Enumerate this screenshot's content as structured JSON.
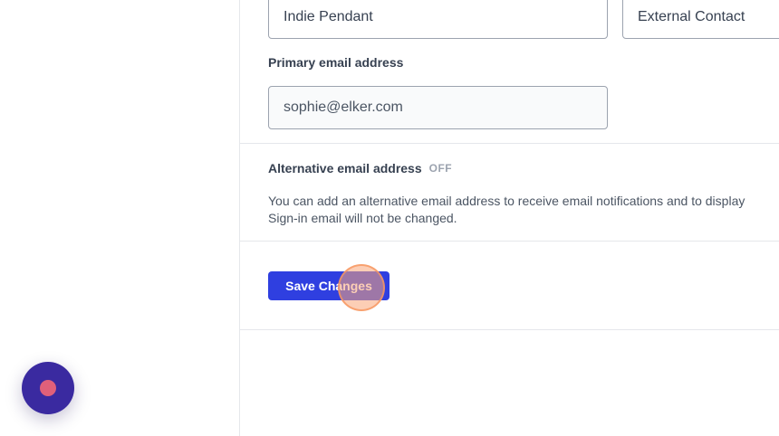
{
  "name_fields": {
    "first_name_value": "Indie Pendant",
    "last_name_value": "External Contact"
  },
  "primary_email": {
    "label": "Primary email address",
    "value": "sophie@elker.com"
  },
  "alternative_email": {
    "label": "Alternative email address",
    "status": "OFF",
    "description_line1": "You can add an alternative email address to receive email notifications and to display",
    "description_line2": "Sign-in email will not be changed."
  },
  "actions": {
    "save_label": "Save Changes",
    "primary_color": "#2f3fe0"
  },
  "chat_launcher": {
    "icon": "chat-bubble-icon",
    "color": "#3a2aa0"
  }
}
